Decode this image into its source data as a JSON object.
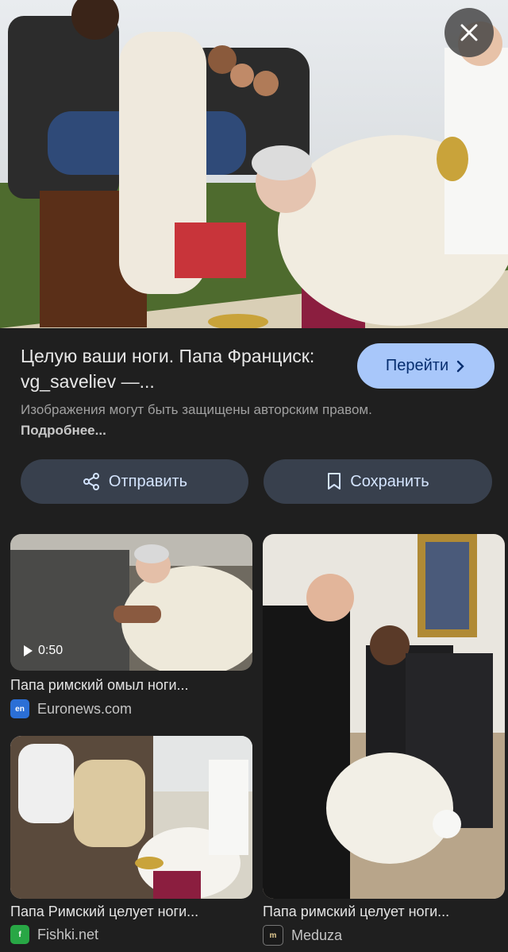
{
  "detail": {
    "title": "Целую ваши ноги. Папа Франциск: vg_saveliev —...",
    "goto_label": "Перейти",
    "copyright_text": "Изображения могут быть защищены авторским правом.",
    "more_link": "Подробнее...",
    "share_label": "Отправить",
    "save_label": "Сохранить"
  },
  "related": [
    {
      "caption": "Папа римский омыл ноги...",
      "source": "Euronews.com",
      "source_icon": "en",
      "video_duration": "0:50"
    },
    {
      "caption": "Папа Римский целует ноги...",
      "source": "Fishki.net",
      "source_icon": "f"
    },
    {
      "caption": "Папа римский целует ноги...",
      "source": "Meduza",
      "source_icon": "m"
    }
  ],
  "colors": {
    "background": "#1f1f1f",
    "primary_button": "#a8c7fa",
    "secondary_button": "#38404d"
  }
}
